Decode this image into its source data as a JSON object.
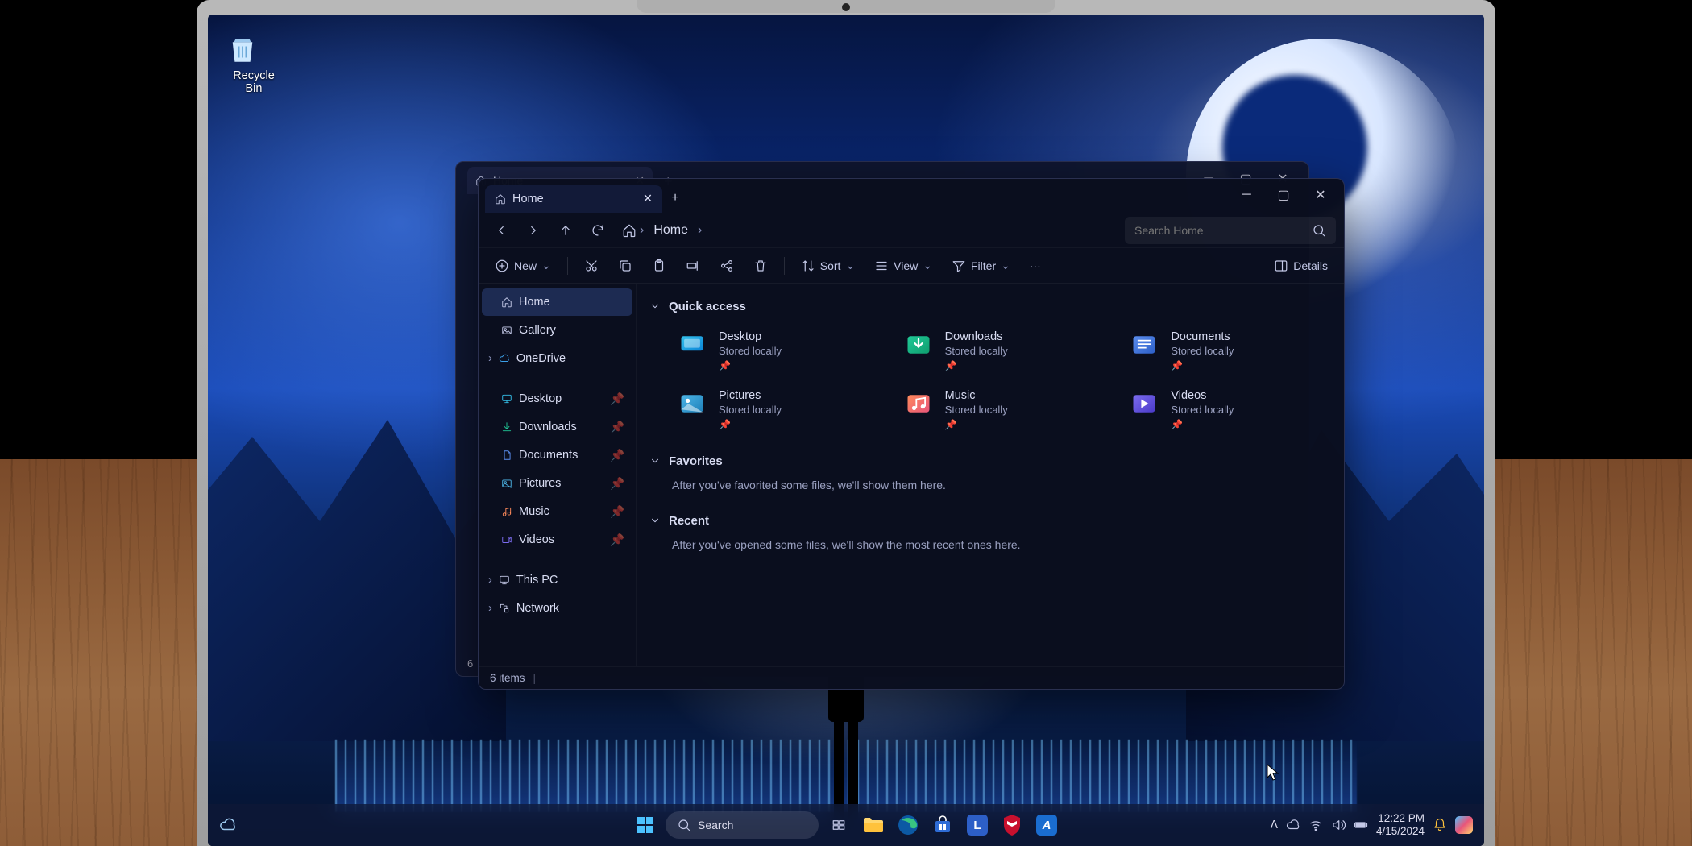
{
  "desktop": {
    "recycle_bin": "Recycle Bin"
  },
  "explorer_back": {
    "tab": "Home",
    "status": "6"
  },
  "explorer": {
    "tab": "Home",
    "breadcrumb": "Home",
    "search_placeholder": "Search Home",
    "toolbar": {
      "new": "New",
      "sort": "Sort",
      "view": "View",
      "filter": "Filter",
      "details": "Details"
    },
    "sidebar": {
      "home": "Home",
      "gallery": "Gallery",
      "onedrive": "OneDrive",
      "desktop": "Desktop",
      "downloads": "Downloads",
      "documents": "Documents",
      "pictures": "Pictures",
      "music": "Music",
      "videos": "Videos",
      "thispc": "This PC",
      "network": "Network"
    },
    "sections": {
      "quick_access": "Quick access",
      "favorites": "Favorites",
      "favorites_empty": "After you've favorited some files, we'll show them here.",
      "recent": "Recent",
      "recent_empty": "After you've opened some files, we'll show the most recent ones here."
    },
    "tiles": [
      {
        "name": "Desktop",
        "sub": "Stored locally",
        "color1": "#35c2ec",
        "color2": "#0a84d8"
      },
      {
        "name": "Downloads",
        "sub": "Stored locally",
        "color1": "#20c997",
        "color2": "#0f9d6e"
      },
      {
        "name": "Documents",
        "sub": "Stored locally",
        "color1": "#5b8def",
        "color2": "#2d5fc7"
      },
      {
        "name": "Pictures",
        "sub": "Stored locally",
        "color1": "#4db6e8",
        "color2": "#1e7fb8"
      },
      {
        "name": "Music",
        "sub": "Stored locally",
        "color1": "#ff8a5b",
        "color2": "#e8557a"
      },
      {
        "name": "Videos",
        "sub": "Stored locally",
        "color1": "#7c6cf0",
        "color2": "#4a3ac8"
      }
    ],
    "status": "6 items"
  },
  "taskbar": {
    "search": "Search",
    "time": "12:22 PM",
    "date": "4/15/2024"
  }
}
